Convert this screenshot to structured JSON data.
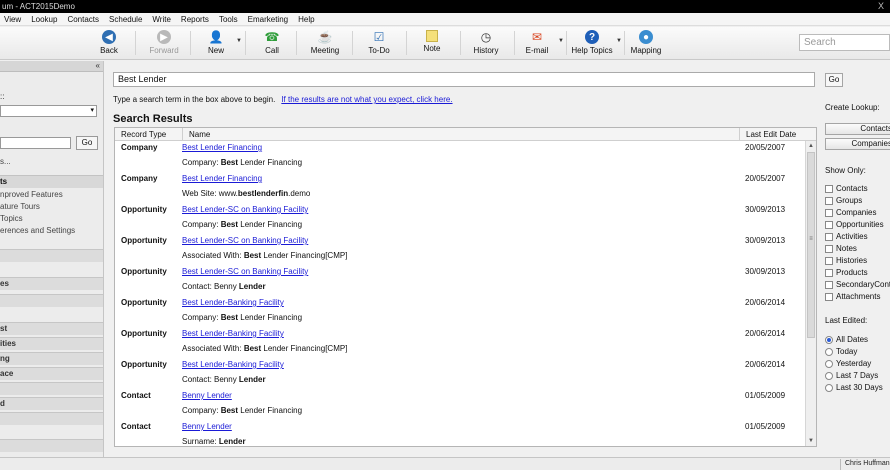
{
  "titlebar": {
    "title": "um - ACT2015Demo",
    "close": "X"
  },
  "menu": [
    "View",
    "Lookup",
    "Contacts",
    "Schedule",
    "Write",
    "Reports",
    "Tools",
    "Emarketing",
    "Help"
  ],
  "toolbar": {
    "back": "Back",
    "forward": "Forward",
    "new": "New",
    "call": "Call",
    "meeting": "Meeting",
    "todo": "To-Do",
    "note": "Note",
    "history": "History",
    "email": "E-mail",
    "help_topics": "Help Topics",
    "mapping": "Mapping",
    "search_placeholder": "Search"
  },
  "leftnav": {
    "collapse": "«",
    "label1": "::",
    "select_arrow": "▾",
    "go": "Go",
    "more": "s...",
    "section_title": "ts",
    "links": [
      "nproved Features",
      "ature Tours",
      "Topics",
      "erences and Settings"
    ],
    "bars": [
      "",
      "es",
      "",
      "st",
      "ities",
      "ng",
      "ace",
      "",
      "d",
      "",
      ""
    ]
  },
  "main": {
    "search_value": "Best Lender",
    "instruction": "Type a search term in the box above to begin.",
    "instruction_link": "If the results are not what you expect, click here.",
    "results_title": "Search Results",
    "columns": {
      "type": "Record Type",
      "name": "Name",
      "date": "Last Edit Date"
    },
    "rows": [
      {
        "type": "Company",
        "name": "Best Lender Financing",
        "date": "20/05/2007",
        "sub_pre": "Company: ",
        "sub_bold": "Best",
        "sub_post": " Lender Financing"
      },
      {
        "type": "Company",
        "name": "Best Lender Financing",
        "date": "20/05/2007",
        "sub_pre": "Web Site: www.",
        "sub_bold": "bestlenderfin",
        "sub_post": ".demo"
      },
      {
        "type": "Opportunity",
        "name": "Best Lender-SC on Banking Facility",
        "date": "30/09/2013",
        "sub_pre": "Company: ",
        "sub_bold": "Best",
        "sub_post": " Lender Financing"
      },
      {
        "type": "Opportunity",
        "name": "Best Lender-SC on Banking Facility",
        "date": "30/09/2013",
        "sub_pre": "Associated With: ",
        "sub_bold": "Best",
        "sub_post": " Lender Financing[CMP]"
      },
      {
        "type": "Opportunity",
        "name": "Best Lender-SC on Banking Facility",
        "date": "30/09/2013",
        "sub_pre": "Contact: Benny ",
        "sub_bold": "Lender",
        "sub_post": ""
      },
      {
        "type": "Opportunity",
        "name": "Best Lender-Banking Facility",
        "date": "20/06/2014",
        "sub_pre": "Company: ",
        "sub_bold": "Best",
        "sub_post": " Lender Financing"
      },
      {
        "type": "Opportunity",
        "name": "Best Lender-Banking Facility",
        "date": "20/06/2014",
        "sub_pre": "Associated With: ",
        "sub_bold": "Best",
        "sub_post": " Lender Financing[CMP]"
      },
      {
        "type": "Opportunity",
        "name": "Best Lender-Banking Facility",
        "date": "20/06/2014",
        "sub_pre": "Contact: Benny ",
        "sub_bold": "Lender",
        "sub_post": ""
      },
      {
        "type": "Contact",
        "name": "Benny Lender",
        "date": "01/05/2009",
        "sub_pre": "Company: ",
        "sub_bold": "Best",
        "sub_post": " Lender Financing"
      },
      {
        "type": "Contact",
        "name": "Benny Lender",
        "date": "01/05/2009",
        "sub_pre": "Surname: ",
        "sub_bold": "Lender",
        "sub_post": ""
      }
    ]
  },
  "right": {
    "go": "Go",
    "create_lookup": "Create Lookup:",
    "contacts_btn": "Contacts",
    "companies_btn": "Companies",
    "show_only": "Show Only:",
    "checkboxes": [
      "Contacts",
      "Groups",
      "Companies",
      "Opportunities",
      "Activities",
      "Notes",
      "Histories",
      "Products",
      "SecondaryContacts",
      "Attachments"
    ],
    "last_edited": "Last Edited:",
    "radios": [
      "All Dates",
      "Today",
      "Yesterday",
      "Last 7 Days",
      "Last 30 Days"
    ],
    "selected_radio": "All Dates"
  },
  "status": {
    "user": "Chris Huffman"
  },
  "colors": {
    "link": "#1a1ad6",
    "back_icon": "#2f6fb3",
    "call_icon": "#2e9d3a",
    "email_icon": "#d9431e",
    "help_icon": "#1f5fb8"
  }
}
